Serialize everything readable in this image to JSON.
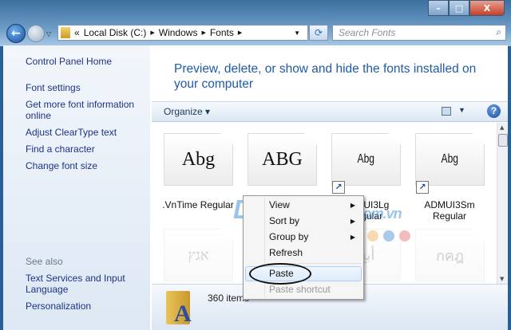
{
  "window": {
    "minimize": "–",
    "maximize": "□",
    "close": "X"
  },
  "address": {
    "overflow": "«",
    "crumbs": [
      "Local Disk (C:)",
      "Windows",
      "Fonts"
    ],
    "search_placeholder": "Search Fonts"
  },
  "left_pane": {
    "items": [
      "Control Panel Home",
      "Font settings",
      "Get more font information online",
      "Adjust ClearType text",
      "Find a character",
      "Change font size"
    ],
    "see_also_label": "See also",
    "see_also": [
      "Text Services and Input Language",
      "Personalization"
    ]
  },
  "header": {
    "title": "Preview, delete, or show and hide the fonts installed on your computer"
  },
  "toolbar": {
    "organize": "Organize ▾",
    "help": "?"
  },
  "fonts": [
    {
      "preview": "Abg",
      "name": ".VnTime Regular",
      "shortcut": false
    },
    {
      "preview": "ABG",
      "name": "",
      "shortcut": false
    },
    {
      "preview": "Abg",
      "name": "ADMUI3Lg Regular",
      "shortcut": true
    },
    {
      "preview": "Abg",
      "name": "ADMUI3Sm Regular",
      "shortcut": true
    },
    {
      "preview": "אגץ",
      "name": ""
    },
    {
      "preview": "",
      "name": ""
    },
    {
      "preview": "أبج",
      "name": ""
    },
    {
      "preview": "กคฎ",
      "name": ""
    }
  ],
  "status": {
    "item_count": "360 items"
  },
  "context_menu": {
    "items": [
      {
        "label": "View",
        "submenu": true
      },
      {
        "label": "Sort by",
        "submenu": true
      },
      {
        "label": "Group by",
        "submenu": true
      },
      {
        "label": "Refresh"
      },
      {
        "label": "Paste",
        "highlighted": true
      },
      {
        "label": "Paste shortcut",
        "disabled": true
      }
    ]
  },
  "watermark": {
    "text": "Download",
    "suffix": ".com.vn",
    "dot_colors": [
      "#7ec8ef",
      "#cfcfcf",
      "#a9d88a",
      "#f4c27f",
      "#6fa6d8",
      "#ef8f8f"
    ]
  }
}
